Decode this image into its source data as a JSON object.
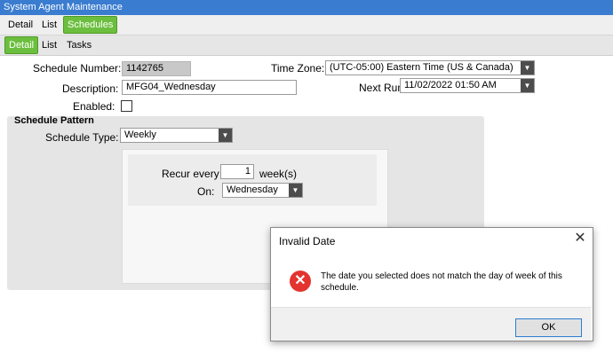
{
  "window": {
    "title": "System Agent Maintenance"
  },
  "tabs_top": [
    "Detail",
    "List",
    "Schedules"
  ],
  "tabs_sub": [
    "Detail",
    "List",
    "Tasks"
  ],
  "form": {
    "schedule_number_label": "Schedule Number:",
    "schedule_number_value": "1142765",
    "description_label": "Description:",
    "description_value": "MFG04_Wednesday",
    "enabled_label": "Enabled:",
    "enabled_checked": false,
    "timezone_label": "Time Zone:",
    "timezone_value": "(UTC-05:00) Eastern Time (US & Canada)",
    "next_run_label": "Next Run",
    "next_run_value": "11/02/2022 01:50 AM"
  },
  "pattern": {
    "group_title": "Schedule Pattern",
    "type_label": "Schedule Type:",
    "type_value": "Weekly",
    "recur_label": "Recur every",
    "recur_value": "1",
    "recur_unit": "week(s)",
    "on_label": "On:",
    "on_value": "Wednesday"
  },
  "dialog": {
    "title": "Invalid Date",
    "close_glyph": "✕",
    "icon_glyph": "✕",
    "message": "The date you selected does not match the day of week of this schedule.",
    "ok_label": "OK"
  },
  "colors": {
    "title_bar": "#3a7ccf",
    "active_tab": "#6cbf3e",
    "error_icon": "#e3342f"
  }
}
